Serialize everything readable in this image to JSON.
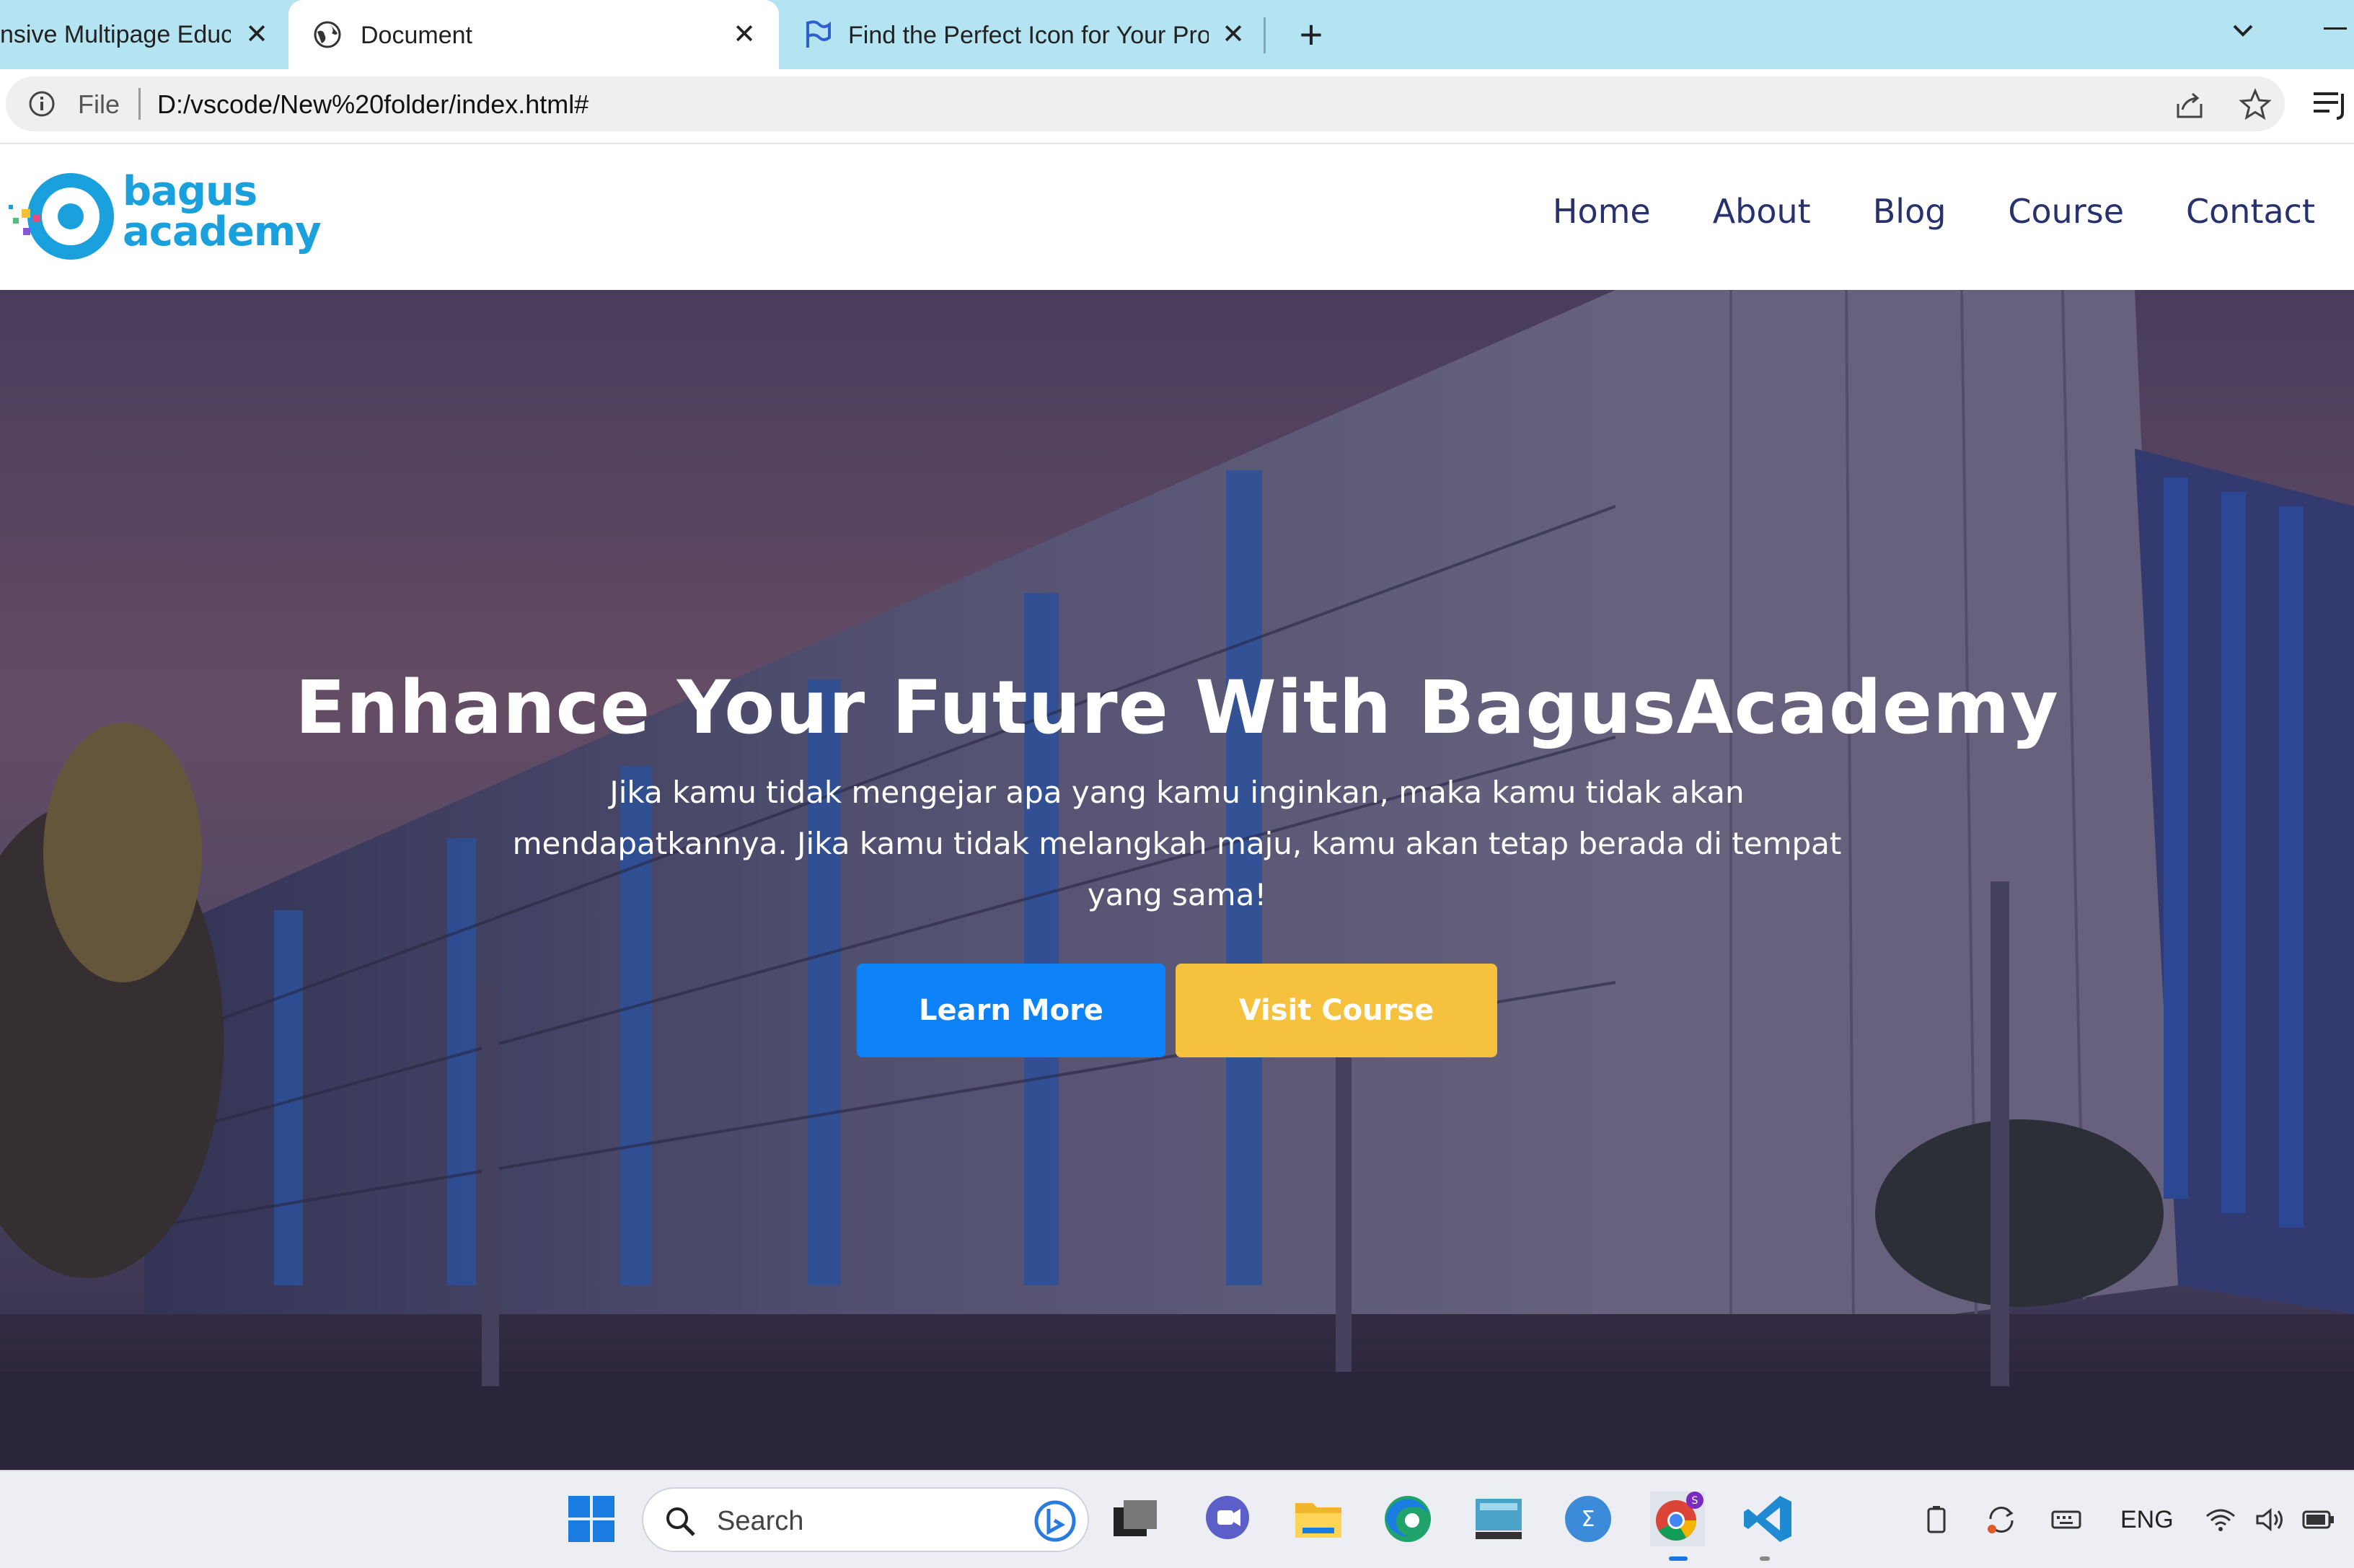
{
  "browser": {
    "tabs": [
      {
        "title": "nsive Multipage Educ",
        "active": false
      },
      {
        "title": "Document",
        "active": true
      },
      {
        "title": "Find the Perfect Icon for Your Pro",
        "active": false
      }
    ],
    "close_glyph": "✕",
    "new_tab_glyph": "+",
    "address": {
      "scheme_label": "File",
      "url": "D:/vscode/New%20folder/index.html#"
    }
  },
  "site": {
    "logo": {
      "line1": "bagus",
      "line2": "academy",
      "color": "#1aa0dc"
    },
    "nav": [
      {
        "label": "Home"
      },
      {
        "label": "About"
      },
      {
        "label": "Blog"
      },
      {
        "label": "Course"
      },
      {
        "label": "Contact"
      }
    ],
    "hero": {
      "title": "Enhance Your Future With BagusAcademy",
      "text": "Jika kamu tidak mengejar apa yang kamu inginkan, maka kamu tidak akan mendapatkannya. Jika kamu tidak melangkah maju, kamu akan tetap berada di tempat yang sama!",
      "primary_button": "Learn More",
      "secondary_button": "Visit Course"
    },
    "colors": {
      "primary": "#0d82f7",
      "secondary": "#f6c23d",
      "nav": "#27316e"
    }
  },
  "taskbar": {
    "search_placeholder": "Search",
    "language": "ENG",
    "chrome_badge": "S",
    "icons": [
      "windows-start-icon",
      "taskview-icon",
      "chat-icon",
      "file-explorer-icon",
      "edge-icon",
      "monitor-app-icon",
      "app-icon",
      "chrome-icon",
      "vscode-icon"
    ]
  }
}
